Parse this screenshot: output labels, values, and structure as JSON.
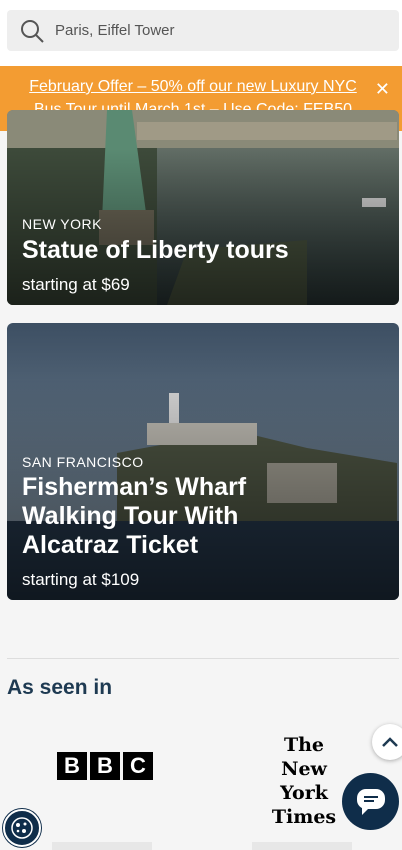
{
  "search": {
    "placeholder": "Paris, Eiffel Tower"
  },
  "banner": {
    "link_text": "February Offer – 50% off our new Luxury NYC Bus Tour until March 1st",
    "code_prefix": " – Use Code: ",
    "code": "FEB50",
    "close_label": "✕"
  },
  "cards": [
    {
      "city": "NEW YORK",
      "title": "Statue of Liberty tours",
      "price": "starting at $69"
    },
    {
      "city": "SAN FRANCISCO",
      "title": "Fisherman’s Wharf Walking Tour With Alcatraz Ticket",
      "price": "starting at $109"
    }
  ],
  "press": {
    "heading": "As seen in",
    "bbc_letters": [
      "B",
      "B",
      "C"
    ],
    "nyt_lines": [
      "The",
      "New York",
      "Times"
    ]
  },
  "colors": {
    "banner": "#f39c32",
    "navy": "#0f2d4a",
    "heading": "#1e3a52"
  }
}
